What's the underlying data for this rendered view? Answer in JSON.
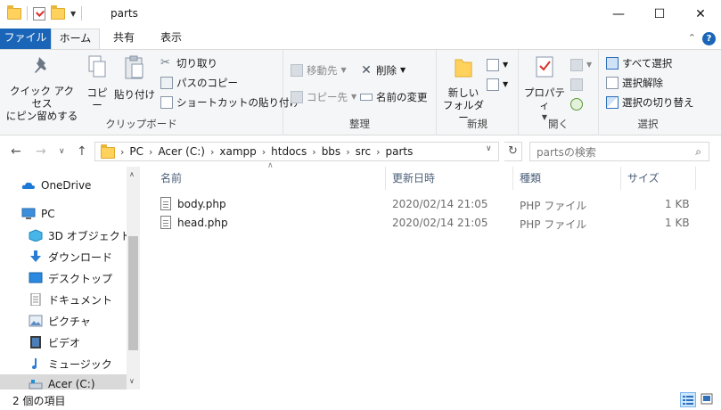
{
  "window": {
    "title": "parts",
    "minimize": "—",
    "maximize": "☐",
    "close": "✕"
  },
  "ribbon_tabs": [
    "ファイル",
    "ホーム",
    "共有",
    "表示"
  ],
  "ribbon": {
    "clipboard": {
      "label": "クリップボード",
      "pin": "クイック アクセス\nにピン留めする",
      "copy": "コピー",
      "paste": "貼り付け",
      "cut": "切り取り",
      "copy_path": "パスのコピー",
      "paste_shortcut": "ショートカットの貼り付け"
    },
    "organize": {
      "label": "整理",
      "move_to": "移動先",
      "copy_to": "コピー先",
      "delete": "削除",
      "rename": "名前の変更"
    },
    "new": {
      "label": "新規",
      "new_folder": "新しい\nフォルダー"
    },
    "open": {
      "label": "開く",
      "properties": "プロパティ"
    },
    "select": {
      "label": "選択",
      "select_all": "すべて選択",
      "select_none": "選択解除",
      "invert": "選択の切り替え"
    }
  },
  "address": {
    "crumbs": [
      "PC",
      "Acer (C:)",
      "xampp",
      "htdocs",
      "bbs",
      "src",
      "parts"
    ],
    "search_placeholder": "partsの検索"
  },
  "nav_pane": [
    {
      "label": "OneDrive",
      "icon": "cloud-icon"
    },
    {
      "label": "PC",
      "icon": "pc-icon"
    },
    {
      "label": "3D オブジェクト",
      "icon": "3d-objects-icon"
    },
    {
      "label": "ダウンロード",
      "icon": "download-icon"
    },
    {
      "label": "デスクトップ",
      "icon": "desktop-icon"
    },
    {
      "label": "ドキュメント",
      "icon": "documents-icon"
    },
    {
      "label": "ピクチャ",
      "icon": "pictures-icon"
    },
    {
      "label": "ビデオ",
      "icon": "videos-icon"
    },
    {
      "label": "ミュージック",
      "icon": "music-icon"
    },
    {
      "label": "Acer (C:)",
      "icon": "drive-icon"
    }
  ],
  "columns": {
    "name": "名前",
    "modified": "更新日時",
    "type": "種類",
    "size": "サイズ"
  },
  "files": [
    {
      "name": "body.php",
      "modified": "2020/02/14 21:05",
      "type": "PHP ファイル",
      "size": "1 KB"
    },
    {
      "name": "head.php",
      "modified": "2020/02/14 21:05",
      "type": "PHP ファイル",
      "size": "1 KB"
    }
  ],
  "status": {
    "count": "2 個の項目"
  }
}
